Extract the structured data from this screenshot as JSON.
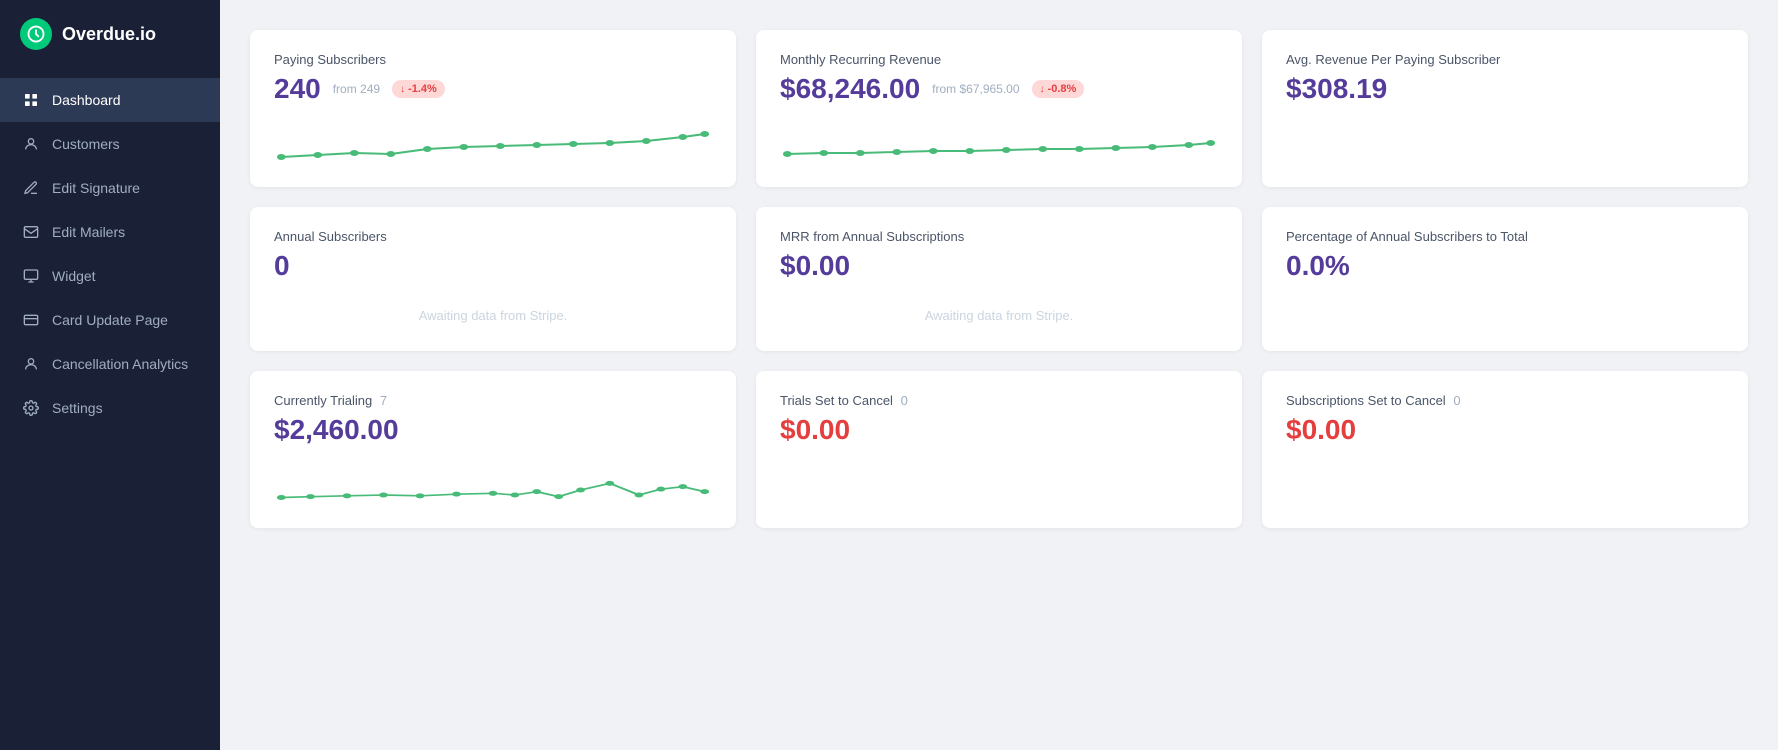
{
  "app": {
    "name": "Overdue.io",
    "logo_symbol": "⏰"
  },
  "sidebar": {
    "items": [
      {
        "id": "dashboard",
        "label": "Dashboard",
        "icon": "▦",
        "active": true
      },
      {
        "id": "customers",
        "label": "Customers",
        "icon": "👤",
        "active": false
      },
      {
        "id": "edit-signature",
        "label": "Edit Signature",
        "icon": "✏️",
        "active": false
      },
      {
        "id": "edit-mailers",
        "label": "Edit Mailers",
        "icon": "✉️",
        "active": false
      },
      {
        "id": "widget",
        "label": "Widget",
        "icon": "🖥",
        "active": false
      },
      {
        "id": "card-update-page",
        "label": "Card Update Page",
        "icon": "💳",
        "active": false
      },
      {
        "id": "cancellation-analytics",
        "label": "Cancellation Analytics",
        "icon": "👤",
        "active": false
      },
      {
        "id": "settings",
        "label": "Settings",
        "icon": "⚙️",
        "active": false
      }
    ]
  },
  "metrics": {
    "row1": [
      {
        "id": "paying-subscribers",
        "title": "Paying Subscribers",
        "value": "240",
        "from_label": "from 249",
        "badge": "-1.4%",
        "badge_type": "red",
        "has_sparkline": true,
        "sparkline_id": "spark1"
      },
      {
        "id": "mrr",
        "title": "Monthly Recurring Revenue",
        "value": "$68,246.00",
        "from_label": "from $67,965.00",
        "badge": "-0.8%",
        "badge_type": "red",
        "has_sparkline": true,
        "sparkline_id": "spark2"
      },
      {
        "id": "avg-revenue",
        "title": "Avg. Revenue Per Paying Subscriber",
        "value": "$308.19",
        "has_sparkline": false
      }
    ],
    "row2": [
      {
        "id": "annual-subscribers",
        "title": "Annual Subscribers",
        "value": "0",
        "awaiting": true,
        "awaiting_text": "Awaiting data from Stripe."
      },
      {
        "id": "mrr-annual",
        "title": "MRR from Annual Subscriptions",
        "value": "$0.00",
        "awaiting": true,
        "awaiting_text": "Awaiting data from Stripe."
      },
      {
        "id": "pct-annual",
        "title": "Percentage of Annual Subscribers to Total",
        "value": "0.0%"
      }
    ],
    "row3": [
      {
        "id": "trialing",
        "title": "Currently Trialing",
        "count": "7",
        "value": "$2,460.00",
        "value_color": "purple",
        "has_sparkline": true,
        "sparkline_id": "spark3"
      },
      {
        "id": "trials-cancel",
        "title": "Trials Set to Cancel",
        "count": "0",
        "value": "$0.00",
        "value_color": "red"
      },
      {
        "id": "subs-cancel",
        "title": "Subscriptions Set to Cancel",
        "count": "0",
        "value": "$0.00",
        "value_color": "red"
      }
    ]
  }
}
